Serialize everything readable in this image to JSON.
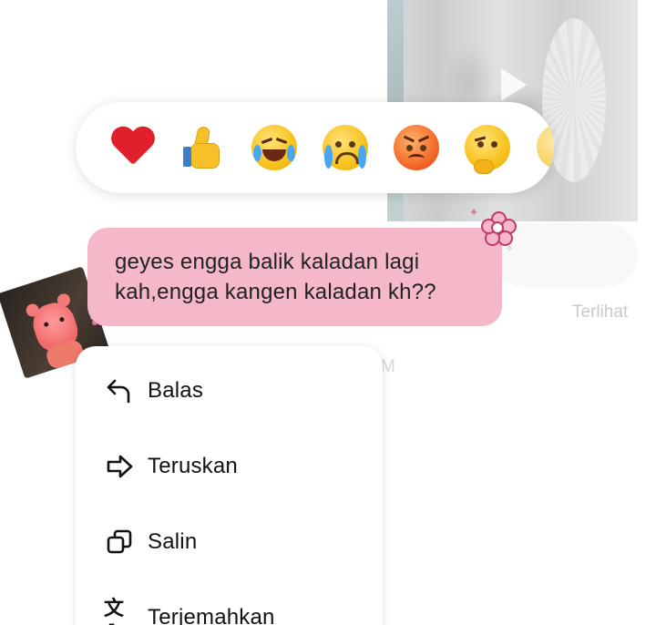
{
  "reactions": [
    {
      "name": "heart",
      "color": "#e0202a"
    },
    {
      "name": "thumbs-up"
    },
    {
      "name": "laughing-tears"
    },
    {
      "name": "crying"
    },
    {
      "name": "angry"
    },
    {
      "name": "thinking"
    }
  ],
  "message": {
    "line1": "geyes engga balik kaladan lagi",
    "line2": "kah,engga kangen kaladan kh??",
    "bubble_color": "#f4b8c9"
  },
  "status": {
    "seen": "Terlihat"
  },
  "menu": {
    "items": [
      {
        "label": "Balas",
        "icon": "reply-icon"
      },
      {
        "label": "Teruskan",
        "icon": "forward-icon"
      },
      {
        "label": "Salin",
        "icon": "copy-icon"
      },
      {
        "label": "Terjemahkan",
        "icon": "translate-icon"
      }
    ]
  }
}
